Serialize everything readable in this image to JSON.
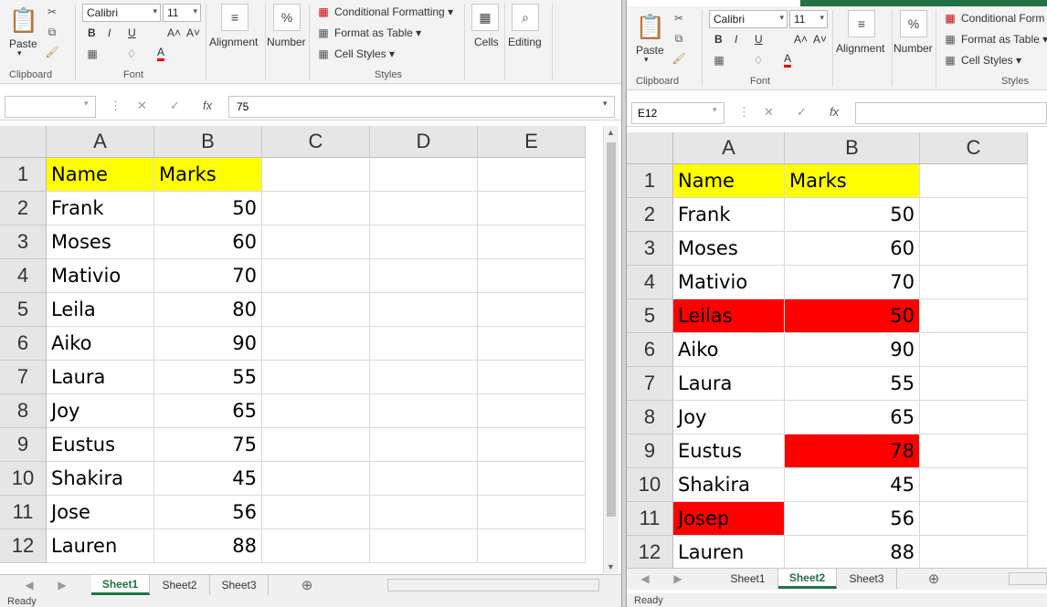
{
  "ribbon": {
    "paste_label": "Paste",
    "clipboard_label": "Clipboard",
    "font_name": "Calibri",
    "font_size": "11",
    "font_label": "Font",
    "bold": "B",
    "italic": "I",
    "underline": "U",
    "grow": "A˄",
    "shrink": "A˅",
    "font_color": "A",
    "alignment_label": "Alignment",
    "number_label": "Number",
    "number_symbol": "%",
    "conditional_formatting": "Conditional Formatting",
    "conditional_formatting_short": "Conditional Form",
    "format_as_table": "Format as Table",
    "cell_styles": "Cell Styles",
    "styles_label": "Styles",
    "cells_label": "Cells",
    "editing_label": "Editing"
  },
  "left_window": {
    "name_box": "",
    "formula_value": "75",
    "columns": [
      "A",
      "B",
      "C",
      "D",
      "E"
    ],
    "rows": [
      {
        "n": "1",
        "a": "Name",
        "b": "Marks"
      },
      {
        "n": "2",
        "a": "Frank",
        "b": "50"
      },
      {
        "n": "3",
        "a": "Moses",
        "b": "60"
      },
      {
        "n": "4",
        "a": "Mativio",
        "b": "70"
      },
      {
        "n": "5",
        "a": "Leila",
        "b": "80"
      },
      {
        "n": "6",
        "a": "Aiko",
        "b": "90"
      },
      {
        "n": "7",
        "a": "Laura",
        "b": "55"
      },
      {
        "n": "8",
        "a": "Joy",
        "b": "65"
      },
      {
        "n": "9",
        "a": "Eustus",
        "b": "75"
      },
      {
        "n": "10",
        "a": "Shakira",
        "b": "45"
      },
      {
        "n": "11",
        "a": "Jose",
        "b": "56"
      },
      {
        "n": "12",
        "a": "Lauren",
        "b": "88"
      }
    ],
    "tabs": [
      "Sheet1",
      "Sheet2",
      "Sheet3"
    ],
    "active_tab": "Sheet1",
    "status": "Ready"
  },
  "right_window": {
    "name_box": "E12",
    "formula_value": "",
    "columns": [
      "A",
      "B",
      "C"
    ],
    "rows": [
      {
        "n": "1",
        "a": "Name",
        "b": "Marks"
      },
      {
        "n": "2",
        "a": "Frank",
        "b": "50"
      },
      {
        "n": "3",
        "a": "Moses",
        "b": "60"
      },
      {
        "n": "4",
        "a": "Mativio",
        "b": "70"
      },
      {
        "n": "5",
        "a": "Leilas",
        "b": "50",
        "red_a": true,
        "red_b": true
      },
      {
        "n": "6",
        "a": "Aiko",
        "b": "90"
      },
      {
        "n": "7",
        "a": "Laura",
        "b": "55"
      },
      {
        "n": "8",
        "a": "Joy",
        "b": "65"
      },
      {
        "n": "9",
        "a": "Eustus",
        "b": "78",
        "red_b": true
      },
      {
        "n": "10",
        "a": "Shakira",
        "b": "45"
      },
      {
        "n": "11",
        "a": "Josep",
        "b": "56",
        "red_a": true
      },
      {
        "n": "12",
        "a": "Lauren",
        "b": "88"
      }
    ],
    "tabs": [
      "Sheet1",
      "Sheet2",
      "Sheet3"
    ],
    "active_tab": "Sheet2",
    "status": "Ready"
  },
  "icons": {
    "cut": "cut-icon",
    "copy": "copy-icon",
    "format_painter": "format-painter-icon",
    "borders": "borders-icon",
    "fill_color": "fill-color-icon",
    "cancel": "cancel-icon",
    "enter": "enter-icon",
    "fx": "fx-icon",
    "add_sheet": "add-sheet-icon"
  },
  "colors": {
    "header_fill": "#ffff00",
    "highlight_red": "#ff0000",
    "excel_green": "#217346"
  }
}
